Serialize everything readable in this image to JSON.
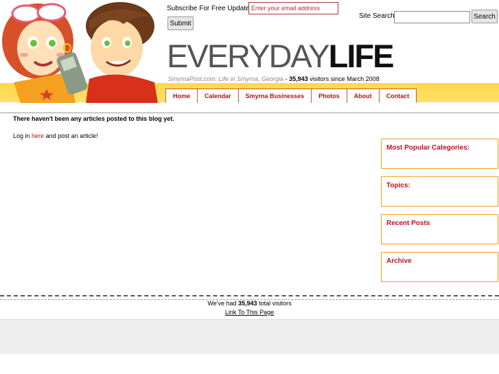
{
  "subscribe": {
    "label": "Subscribe For Free Updates:",
    "email_placeholder": "Enter your email address",
    "submit_label": "Submit"
  },
  "search": {
    "label": "Site Search:",
    "value": "",
    "button_label": "Search"
  },
  "logo": {
    "light": "EVERYDAY",
    "bold": "LIFE"
  },
  "tagline": {
    "site": "SmyrnaPost.com: Life in Smyrna, Georgia",
    "separator": "-",
    "visitors": "35,943",
    "suffix": "visitors since March 2008"
  },
  "nav": {
    "items": [
      "Home",
      "Calendar",
      "Smyrna Businesses",
      "Photos",
      "About",
      "Contact"
    ]
  },
  "main": {
    "no_articles": "There haven't been any articles posted to this blog yet.",
    "login_prefix": "Log in",
    "login_link": "here",
    "login_suffix": "and post an article!"
  },
  "sidebar": {
    "boxes": [
      "Most Popular Categories:",
      "Topics:",
      "Recent Posts",
      "Archive"
    ]
  },
  "footer": {
    "prefix": "We've had",
    "count": "35,943",
    "suffix": "total visitors",
    "link": "Link To This Page"
  },
  "colors": {
    "accent_red": "#c0101a",
    "band_yellow": "#ffd84a",
    "sidebar_border": "#f0a020"
  }
}
